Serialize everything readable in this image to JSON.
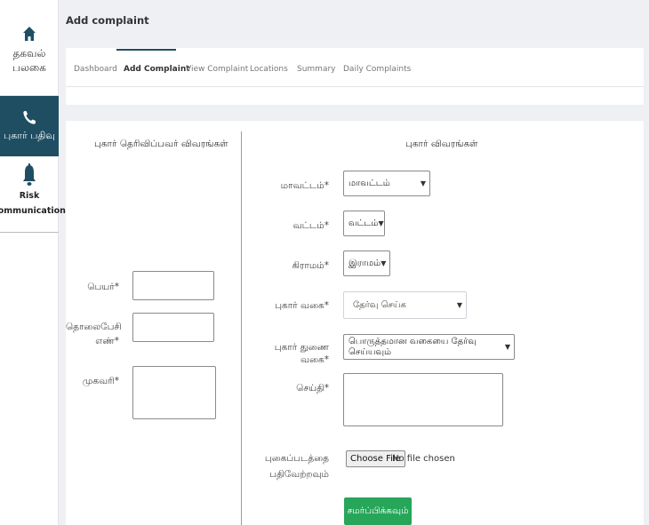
{
  "page": {
    "title": "Add complaint"
  },
  "sidebar": {
    "items": [
      {
        "label_line1": "தகவல்",
        "label_line2": "பலகை",
        "icon": "home-icon"
      },
      {
        "label": "புகார் பதிவு",
        "icon": "phone-icon"
      },
      {
        "label_line1": "Risk",
        "label_line2": "communication",
        "icon": "bell-icon"
      }
    ]
  },
  "tabs": [
    {
      "label": "Dashboard"
    },
    {
      "label": "Add Complaint"
    },
    {
      "label": "View Complaint"
    },
    {
      "label": "Locations"
    },
    {
      "label": "Summary"
    },
    {
      "label": "Daily Complaints"
    }
  ],
  "complainant": {
    "title": "புகார் தெரிவிப்பவர் விவரங்கள்",
    "name_label": "பெயர்*",
    "phone_label_line1": "தொலைபேசி",
    "phone_label_line2": "எண்*",
    "address_label": "முகவரி*"
  },
  "complaint": {
    "title": "புகார் விவரங்கள்",
    "district_label": "மாவட்டம்*",
    "district_value": "மாவட்டம்",
    "taluk_label": "வட்டம்*",
    "taluk_value": "வட்டம்",
    "village_label": "கிராமம்*",
    "village_value": "இராமம்",
    "type_label": "புகார் வகை*",
    "type_value": "தேர்வு செய்க",
    "subtype_label": "புகார் துணை வகை*",
    "subtype_value": "பொருத்தமான வகையை தேர்வு செய்யவும்",
    "message_label": "செய்தி*",
    "photo_label_line1": "புகைப்படத்தை",
    "photo_label_line2": "பதிவேற்றவும்",
    "file_button": "Choose File",
    "file_status": "No file chosen",
    "submit_label": "சமர்ப்பிக்கவும்"
  },
  "colors": {
    "sidebar_active": "#1f4e63",
    "submit": "#27a65a",
    "background": "#eef0f4"
  }
}
